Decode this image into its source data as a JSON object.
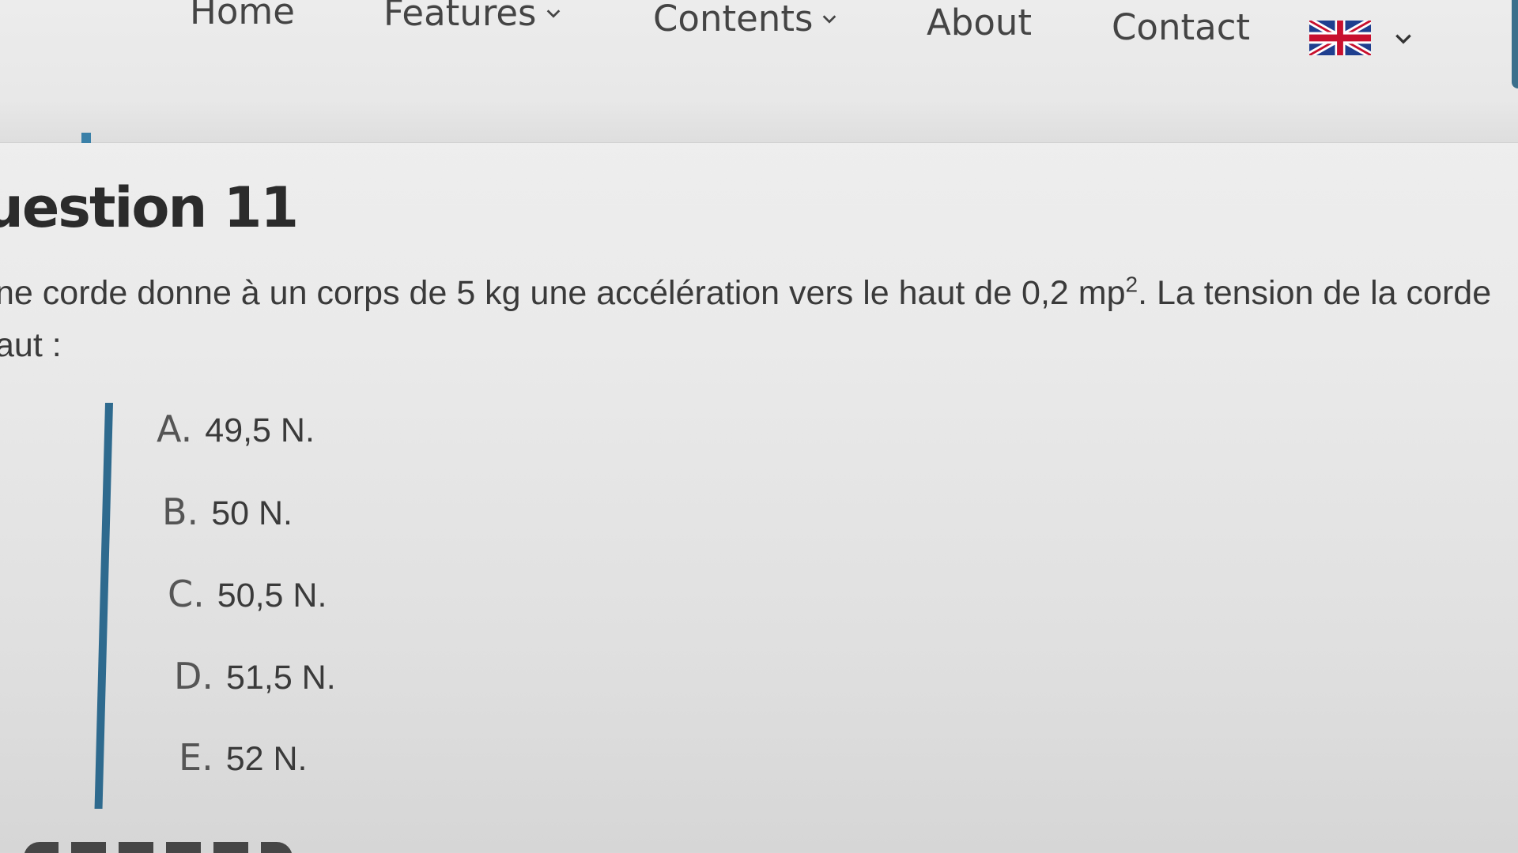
{
  "nav": {
    "items": [
      {
        "label": "Home",
        "has_dropdown": false
      },
      {
        "label": "Features",
        "has_dropdown": true
      },
      {
        "label": "Contents",
        "has_dropdown": true
      },
      {
        "label": "About",
        "has_dropdown": false
      },
      {
        "label": "Contact",
        "has_dropdown": false
      }
    ],
    "language": {
      "icon": "uk-flag-icon",
      "dropdown_icon": "chevron-down-icon"
    }
  },
  "question": {
    "title": "uestion 11",
    "text_before_sup": "ne corde donne à un corps de 5 kg une accélération vers le haut de 0,2 mp",
    "text_sup": "2",
    "text_after_sup": ". La tension de la corde",
    "text_line2": "aut :",
    "options": [
      {
        "letter": "A.",
        "text": "49,5 N."
      },
      {
        "letter": "B.",
        "text": "50 N."
      },
      {
        "letter": "C.",
        "text": "50,5 N."
      },
      {
        "letter": "D.",
        "text": "51,5 N."
      },
      {
        "letter": "E.",
        "text": "52 N."
      }
    ]
  },
  "colors": {
    "accent": "#2e6a8e",
    "text": "#3a3a3a",
    "background": "#e8e8e8"
  }
}
